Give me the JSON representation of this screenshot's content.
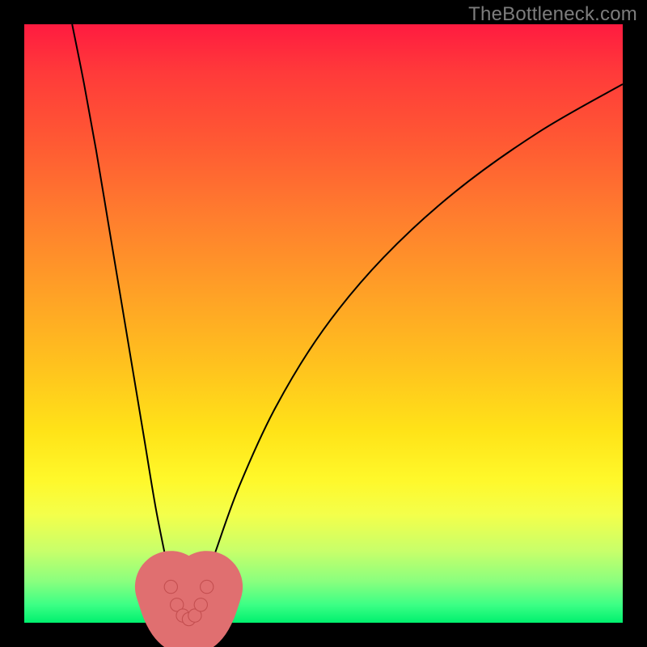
{
  "attribution": "TheBottleneck.com",
  "colors": {
    "frame": "#000000",
    "curve": "#000000",
    "marker_fill": "#e06f70",
    "marker_stroke": "#c44f50",
    "gradient_top": "#ff1b40",
    "gradient_bottom": "#00f06e"
  },
  "chart_data": {
    "type": "line",
    "title": "",
    "xlabel": "",
    "ylabel": "",
    "xlim": [
      0,
      100
    ],
    "ylim": [
      0,
      100
    ],
    "series": [
      {
        "name": "bottleneck-curve",
        "x": [
          8,
          10,
          12,
          14,
          16,
          18,
          20,
          22,
          24,
          25,
          26,
          27,
          28,
          29,
          30,
          32,
          36,
          42,
          50,
          60,
          72,
          86,
          100
        ],
        "y": [
          100,
          90,
          79,
          67,
          55,
          43,
          31,
          19,
          9,
          4,
          1,
          0,
          1,
          3,
          6,
          12,
          23,
          36,
          49,
          61,
          72,
          82,
          90
        ]
      },
      {
        "name": "highlight-markers",
        "x": [
          24.5,
          25.5,
          26.5,
          27.5,
          28.5,
          29.5,
          30.5
        ],
        "y": [
          6,
          3,
          1.2,
          0.6,
          1.2,
          3,
          6
        ]
      }
    ],
    "notch": {
      "x": 27,
      "y_min": 0
    }
  }
}
